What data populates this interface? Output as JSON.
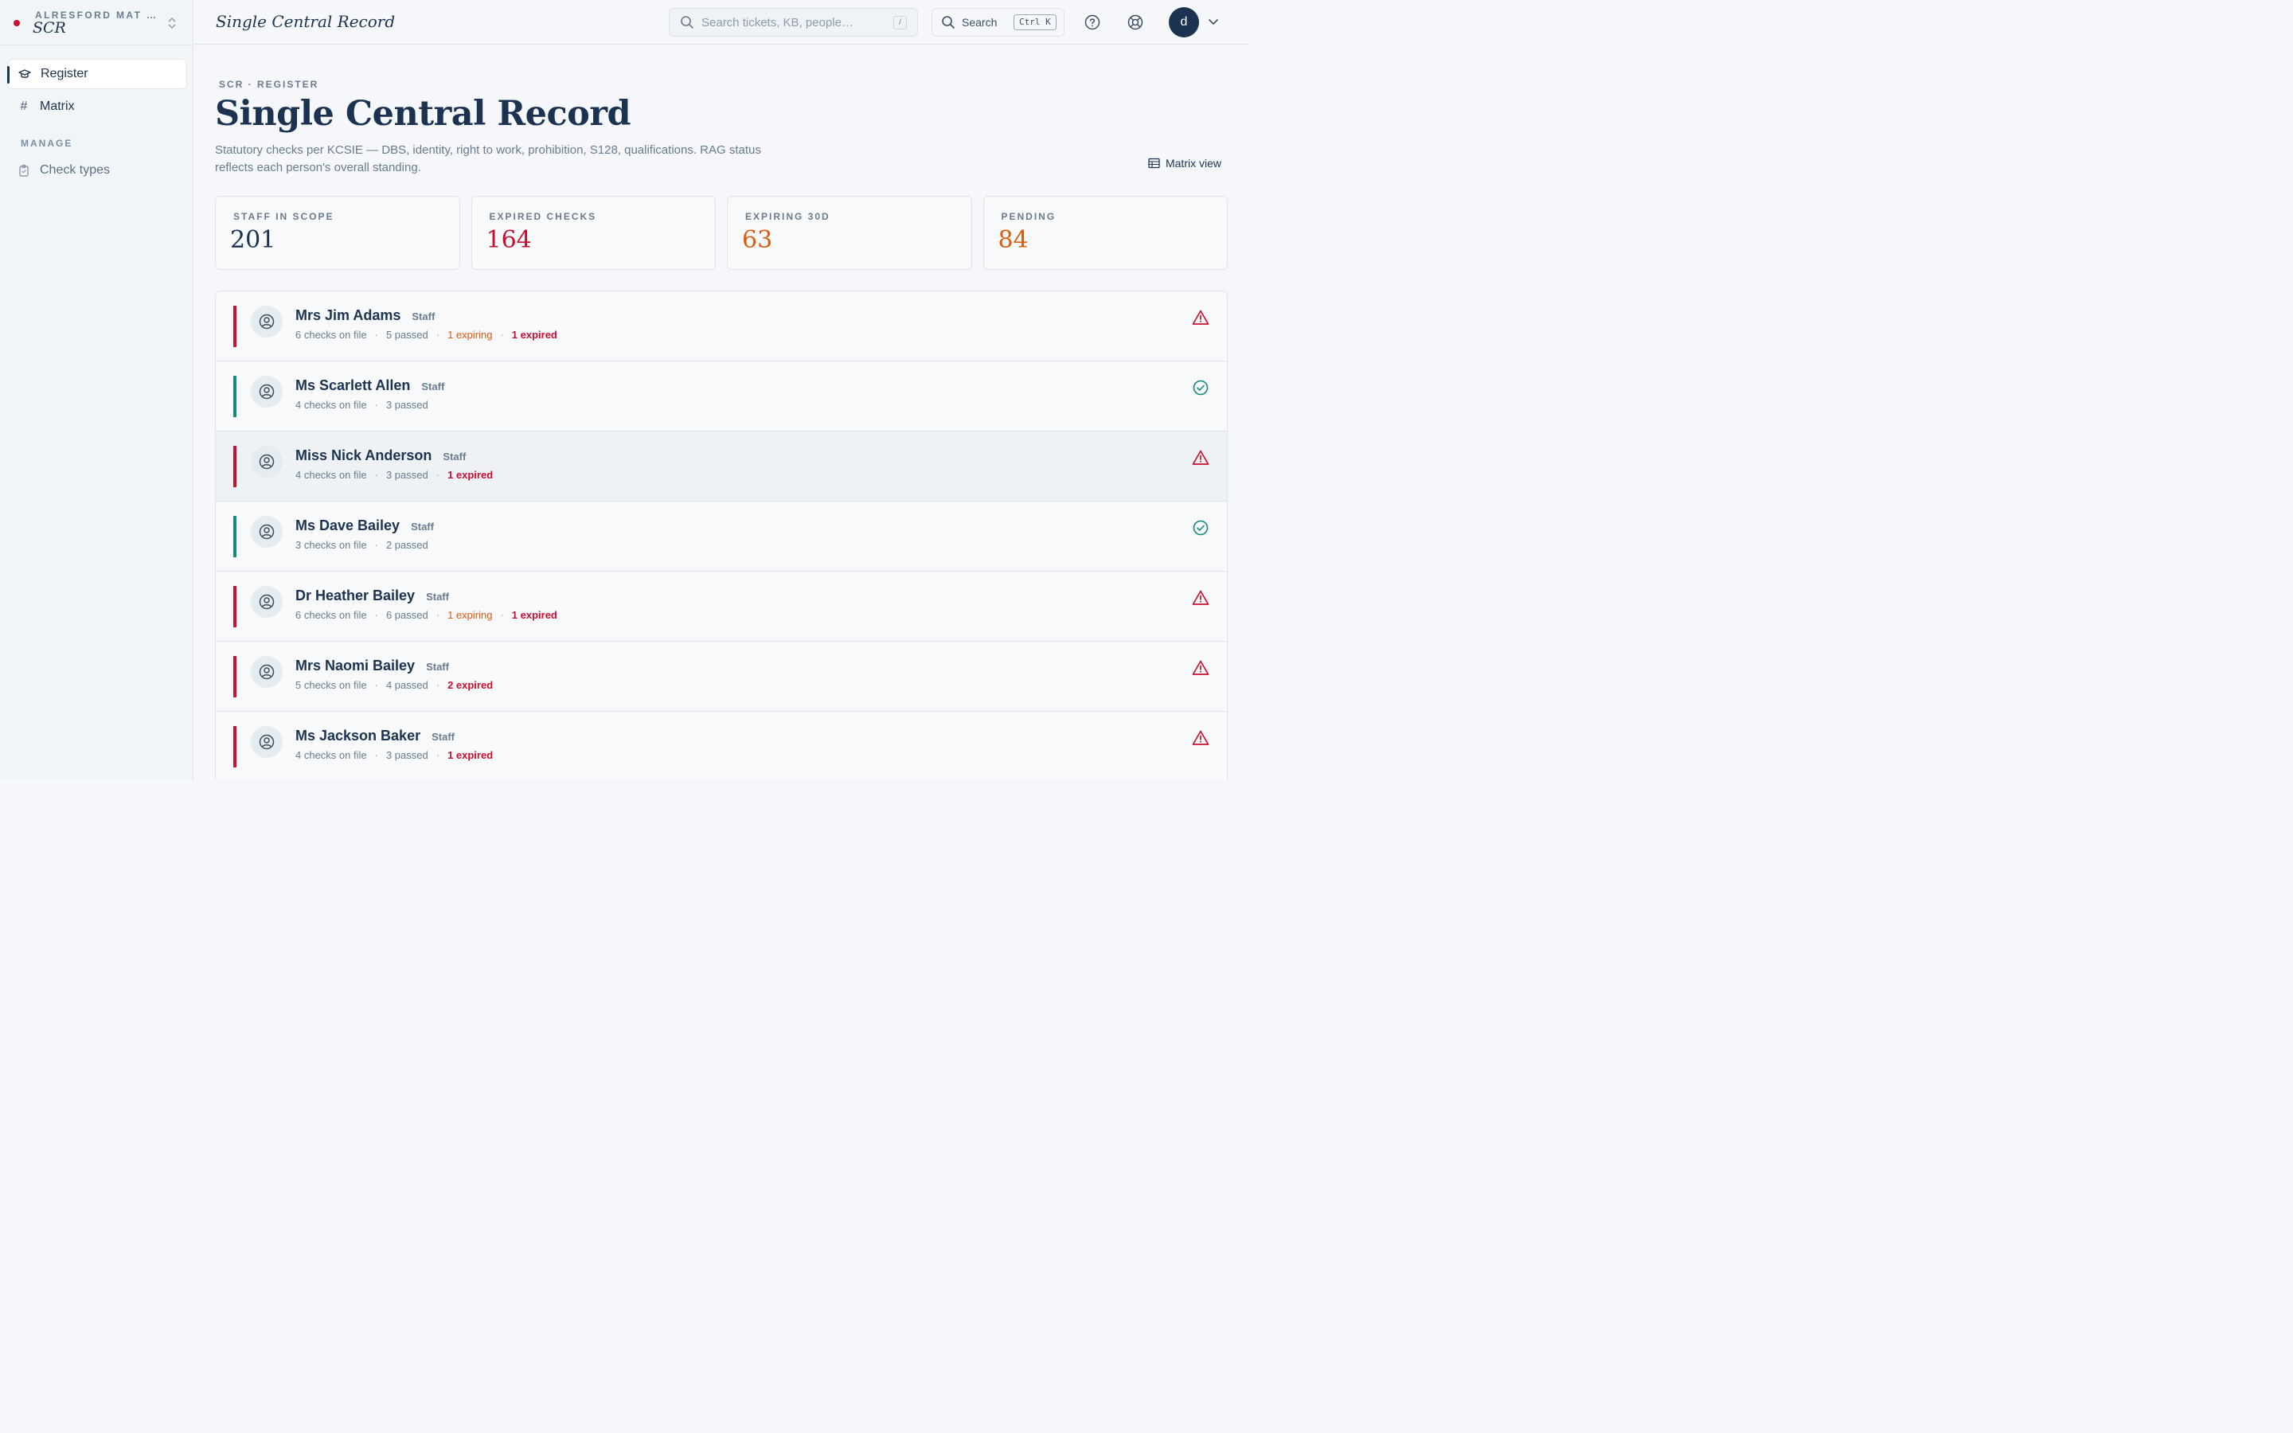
{
  "sidebar": {
    "org_name": "ALRESFORD MAT …",
    "app_name": "SCR",
    "nav": [
      {
        "label": "Register"
      },
      {
        "label": "Matrix"
      }
    ],
    "section_label": "MANAGE",
    "manage_items": [
      {
        "label": "Check types"
      }
    ]
  },
  "topbar": {
    "title": "Single Central Record",
    "search_placeholder": "Search tickets, KB, people…",
    "search_shortcut": "/",
    "search_button_label": "Search",
    "search_button_shortcut": "Ctrl K",
    "user_initial": "d"
  },
  "page": {
    "breadcrumb": "SCR · REGISTER",
    "title": "Single Central Record",
    "description": "Statutory checks per KCSIE — DBS, identity, right to work, prohibition, S128, qualifications. RAG status reflects each person's overall standing.",
    "matrix_view_label": "Matrix view"
  },
  "stats": [
    {
      "label": "STAFF IN SCOPE",
      "value": "201",
      "color": "#1b3350"
    },
    {
      "label": "EXPIRED CHECKS",
      "value": "164",
      "color": "#c8102e"
    },
    {
      "label": "EXPIRING 30D",
      "value": "63",
      "color": "#e05a10"
    },
    {
      "label": "PENDING",
      "value": "84",
      "color": "#e05a10"
    }
  ],
  "people": [
    {
      "name": "Mrs Jim Adams",
      "role": "Staff",
      "checks": "6 checks on file",
      "passed": "5 passed",
      "expiring": "1 expiring",
      "expired": "1 expired",
      "rag": "red",
      "status_icon": "warning-icon"
    },
    {
      "name": "Ms Scarlett Allen",
      "role": "Staff",
      "checks": "4 checks on file",
      "passed": "3 passed",
      "expiring": "",
      "expired": "",
      "rag": "green",
      "status_icon": "check-circle-icon"
    },
    {
      "name": "Miss Nick Anderson",
      "role": "Staff",
      "checks": "4 checks on file",
      "passed": "3 passed",
      "expiring": "",
      "expired": "1 expired",
      "rag": "red",
      "status_icon": "warning-icon"
    },
    {
      "name": "Ms Dave Bailey",
      "role": "Staff",
      "checks": "3 checks on file",
      "passed": "2 passed",
      "expiring": "",
      "expired": "",
      "rag": "green",
      "status_icon": "check-circle-icon"
    },
    {
      "name": "Dr Heather Bailey",
      "role": "Staff",
      "checks": "6 checks on file",
      "passed": "6 passed",
      "expiring": "1 expiring",
      "expired": "1 expired",
      "rag": "red",
      "status_icon": "warning-icon"
    },
    {
      "name": "Mrs Naomi Bailey",
      "role": "Staff",
      "checks": "5 checks on file",
      "passed": "4 passed",
      "expiring": "",
      "expired": "2 expired",
      "rag": "red",
      "status_icon": "warning-icon"
    },
    {
      "name": "Ms Jackson Baker",
      "role": "Staff",
      "checks": "4 checks on file",
      "passed": "3 passed",
      "expiring": "",
      "expired": "1 expired",
      "rag": "red",
      "status_icon": "warning-icon"
    }
  ]
}
